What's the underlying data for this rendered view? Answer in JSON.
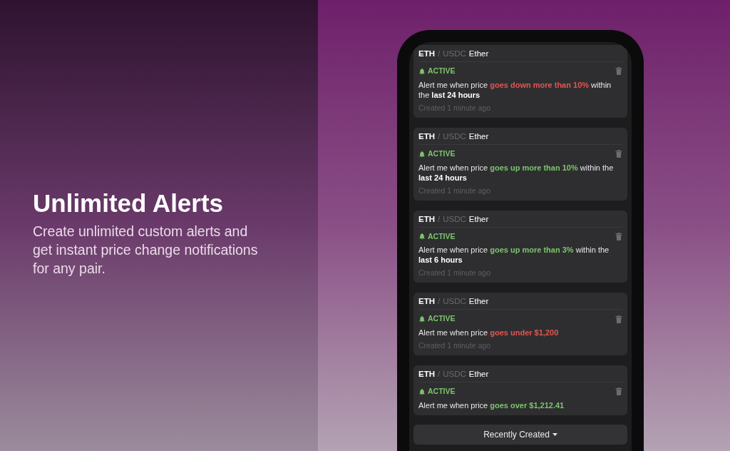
{
  "promo": {
    "title": "Unlimited Alerts",
    "subtitle": "Create unlimited custom alerts and get instant price change notifications for any pair."
  },
  "alerts": [
    {
      "base": "ETH",
      "separator": "/",
      "quote": "USDC",
      "name": "Ether",
      "status": "ACTIVE",
      "prefix": "Alert me when price",
      "condition": "goes down more than 10%",
      "color": "#e5554f",
      "suffix": "within the",
      "period": "last 24 hours",
      "created": "Created 1 minute ago"
    },
    {
      "base": "ETH",
      "separator": "/",
      "quote": "USDC",
      "name": "Ether",
      "status": "ACTIVE",
      "prefix": "Alert me when price",
      "condition": "goes up more than 10%",
      "color": "#7cc56a",
      "suffix": "within the",
      "period": "last 24 hours",
      "created": "Created 1 minute ago"
    },
    {
      "base": "ETH",
      "separator": "/",
      "quote": "USDC",
      "name": "Ether",
      "status": "ACTIVE",
      "prefix": "Alert me when price",
      "condition": "goes up more than 3%",
      "color": "#7cc56a",
      "suffix": "within the",
      "period": "last 6 hours",
      "created": "Created 1 minute ago"
    },
    {
      "base": "ETH",
      "separator": "/",
      "quote": "USDC",
      "name": "Ether",
      "status": "ACTIVE",
      "prefix": "Alert me when price",
      "condition": "goes under $1,200",
      "color": "#e5554f",
      "created": "Created 1 minute ago"
    },
    {
      "base": "ETH",
      "separator": "/",
      "quote": "USDC",
      "name": "Ether",
      "status": "ACTIVE",
      "prefix": "Alert me when price",
      "condition": "goes over $1,212.41",
      "color": "#7cc56a"
    }
  ],
  "sort_button": {
    "label": "Recently Created"
  }
}
